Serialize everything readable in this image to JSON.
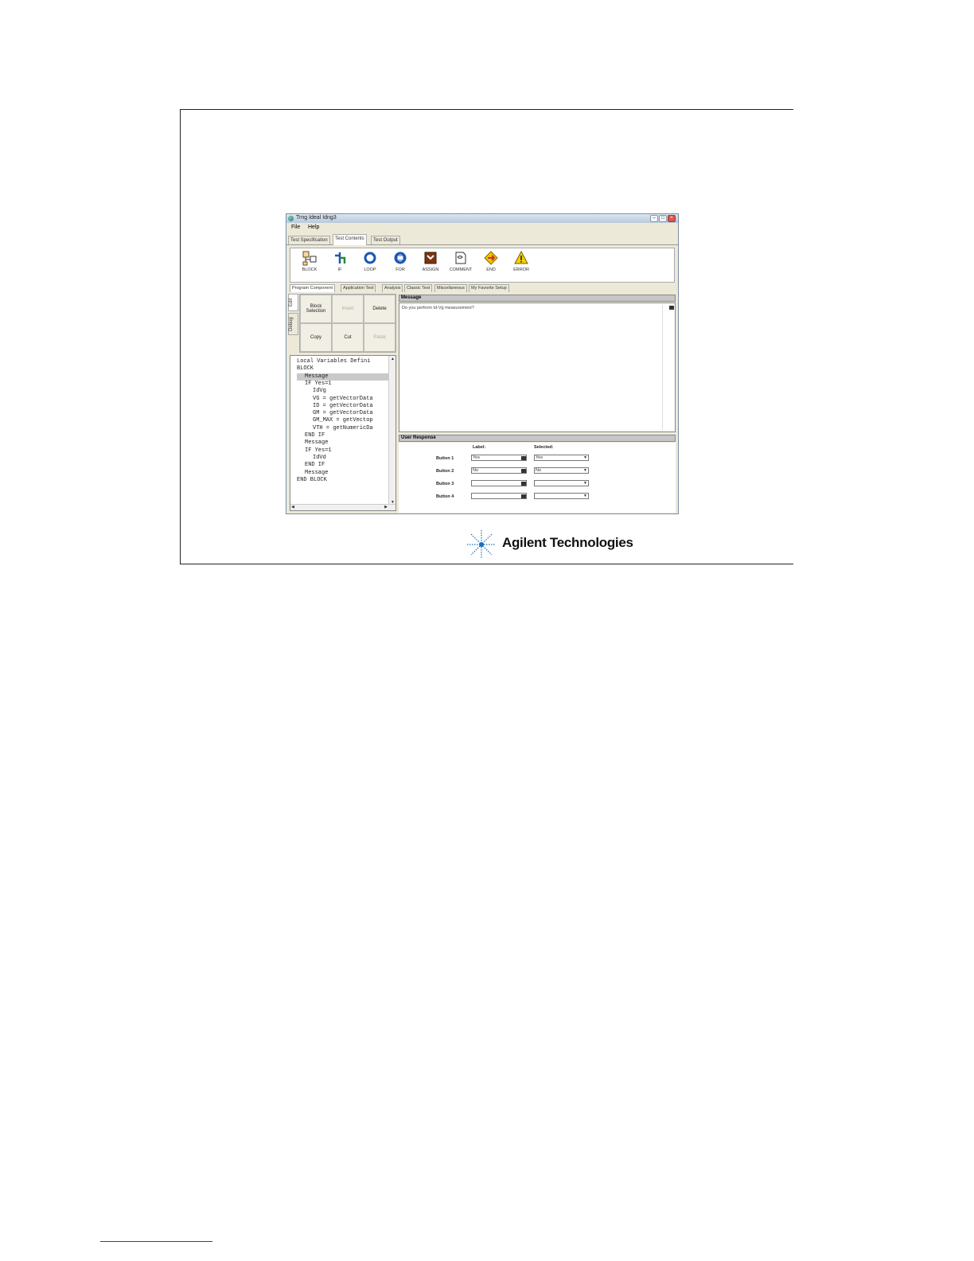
{
  "window": {
    "title": "Trng Ideal Idng3",
    "controls": [
      "minimize-icon",
      "maximize-icon",
      "close-icon"
    ]
  },
  "menu": [
    "File",
    "Help"
  ],
  "top_tabs": [
    "Test Specification",
    "Test Contents",
    "Test Output"
  ],
  "active_top_tab": "Test Contents",
  "toolbar": [
    {
      "label": "BLOCK",
      "icon": "block-icon"
    },
    {
      "label": "IF",
      "icon": "if-icon"
    },
    {
      "label": "LOOP",
      "icon": "loop-icon"
    },
    {
      "label": "FOR",
      "icon": "for-icon"
    },
    {
      "label": "ASSIGN",
      "icon": "assign-icon"
    },
    {
      "label": "COMMENT",
      "icon": "comment-icon"
    },
    {
      "label": "END",
      "icon": "end-icon"
    },
    {
      "label": "ERROR",
      "icon": "error-icon"
    }
  ],
  "palette_tabs": [
    "Program Component",
    "Application Test",
    "Analysis",
    "Classic Test",
    "Miscellaneous",
    "My Favorite Setup"
  ],
  "side_tabs": [
    "Edit",
    "Debug"
  ],
  "edit_buttons": [
    {
      "label": "Block Selection",
      "enabled": true
    },
    {
      "label": "Insert",
      "enabled": false
    },
    {
      "label": "Delete",
      "enabled": true
    },
    {
      "label": "Copy",
      "enabled": true
    },
    {
      "label": "Cut",
      "enabled": true
    },
    {
      "label": "Paste",
      "enabled": false
    }
  ],
  "tree": [
    {
      "text": "Local Variables Defini",
      "indent": 0
    },
    {
      "text": "BLOCK",
      "indent": 0
    },
    {
      "text": "Message",
      "indent": 1,
      "selected": true
    },
    {
      "text": "IF Yes=1",
      "indent": 1
    },
    {
      "text": "IdVg",
      "indent": 2
    },
    {
      "text": "VG = getVectorData",
      "indent": 2
    },
    {
      "text": "ID = getVectorData",
      "indent": 2
    },
    {
      "text": "GM = getVectorData",
      "indent": 2
    },
    {
      "text": "GM_MAX = getVectop",
      "indent": 2
    },
    {
      "text": "VTH = getNumericDa",
      "indent": 2
    },
    {
      "text": "END IF",
      "indent": 1
    },
    {
      "text": "Message",
      "indent": 1
    },
    {
      "text": "IF Yes=1",
      "indent": 1
    },
    {
      "text": "IdVd",
      "indent": 2
    },
    {
      "text": "END IF",
      "indent": 1
    },
    {
      "text": "Message",
      "indent": 1
    },
    {
      "text": "END BLOCK",
      "indent": 0
    }
  ],
  "message": {
    "header": "Message",
    "text": "Do you perform Id-Vg measurement?"
  },
  "user_response": {
    "header": "User Response",
    "label_col": "Label:",
    "selected_col": "Selected:",
    "rows": [
      {
        "name": "Button 1",
        "label": "Yes",
        "selected": "Yes"
      },
      {
        "name": "Button 2",
        "label": "No",
        "selected": "No"
      },
      {
        "name": "Button 3",
        "label": "",
        "selected": ""
      },
      {
        "name": "Button 4",
        "label": "",
        "selected": ""
      }
    ]
  },
  "logo": {
    "text": "Agilent Technologies"
  }
}
